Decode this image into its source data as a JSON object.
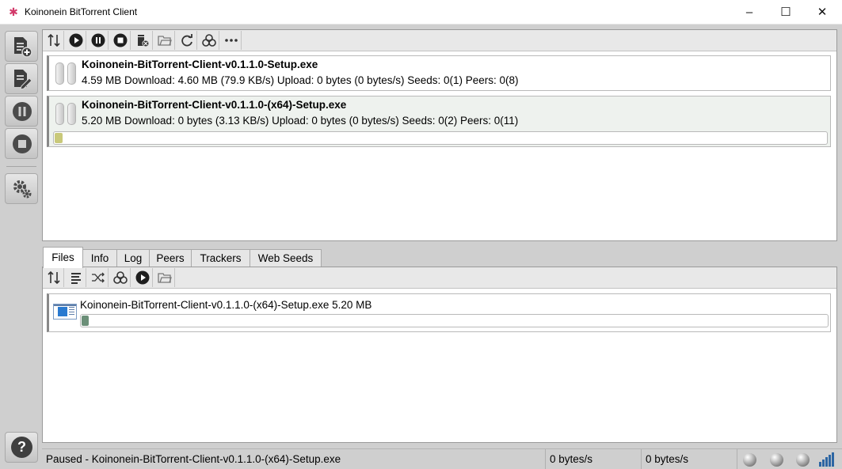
{
  "window": {
    "title": "Koinonein BitTorrent Client",
    "controls": [
      "minimize",
      "maximize",
      "close"
    ]
  },
  "sidebar": {
    "buttons": [
      {
        "name": "add-torrent-file",
        "icon": "add-file-icon"
      },
      {
        "name": "edit-torrent",
        "icon": "edit-file-icon"
      },
      {
        "name": "pause-all",
        "icon": "pause-circle-icon"
      },
      {
        "name": "stop-all",
        "icon": "stop-circle-icon"
      },
      {
        "name": "settings",
        "icon": "gears-icon"
      }
    ],
    "help_label": "?"
  },
  "toolbar": {
    "buttons": [
      "sort-icon",
      "play-icon",
      "pause-icon",
      "stop-icon",
      "delete-icon",
      "open-folder-icon",
      "refresh-icon",
      "biohazard-icon",
      "more-icon"
    ]
  },
  "torrents": [
    {
      "name": "Koinonein-BitTorrent-Client-v0.1.1.0-Setup.exe",
      "stats": "4.59 MB Download: 4.60 MB (79.9 KB/s) Upload: 0 bytes (0 bytes/s) Seeds: 0(1) Peers: 0(8)",
      "state": "paused"
    },
    {
      "name": "Koinonein-BitTorrent-Client-v0.1.1.0-(x64)-Setup.exe",
      "stats": "5.20 MB Download: 0 bytes (3.13 KB/s) Upload: 0 bytes (0 bytes/s) Seeds: 0(2) Peers: 0(11)",
      "state": "paused",
      "selected": true,
      "progress": 0.01
    }
  ],
  "tabs": [
    {
      "label": "Files",
      "active": true
    },
    {
      "label": "Info"
    },
    {
      "label": "Log"
    },
    {
      "label": "Peers"
    },
    {
      "label": "Trackers"
    },
    {
      "label": "Web Seeds"
    }
  ],
  "files_toolbar": {
    "buttons": [
      "sort-icon",
      "priority-list-icon",
      "shuffle-icon",
      "biohazard-icon",
      "play-icon",
      "open-folder-icon"
    ]
  },
  "files": [
    {
      "label": "Koinonein-BitTorrent-Client-v0.1.1.0-(x64)-Setup.exe 5.20 MB",
      "progress": 0.01
    }
  ],
  "statusbar": {
    "message": "Paused - Koinonein-BitTorrent-Client-v0.1.1.0-(x64)-Setup.exe",
    "download_rate": "0 bytes/s",
    "upload_rate": "0 bytes/s"
  },
  "colors": {
    "torrent_progress": "#c9c97a",
    "file_progress": "#6b8f78",
    "signal": "#2d66a3"
  }
}
